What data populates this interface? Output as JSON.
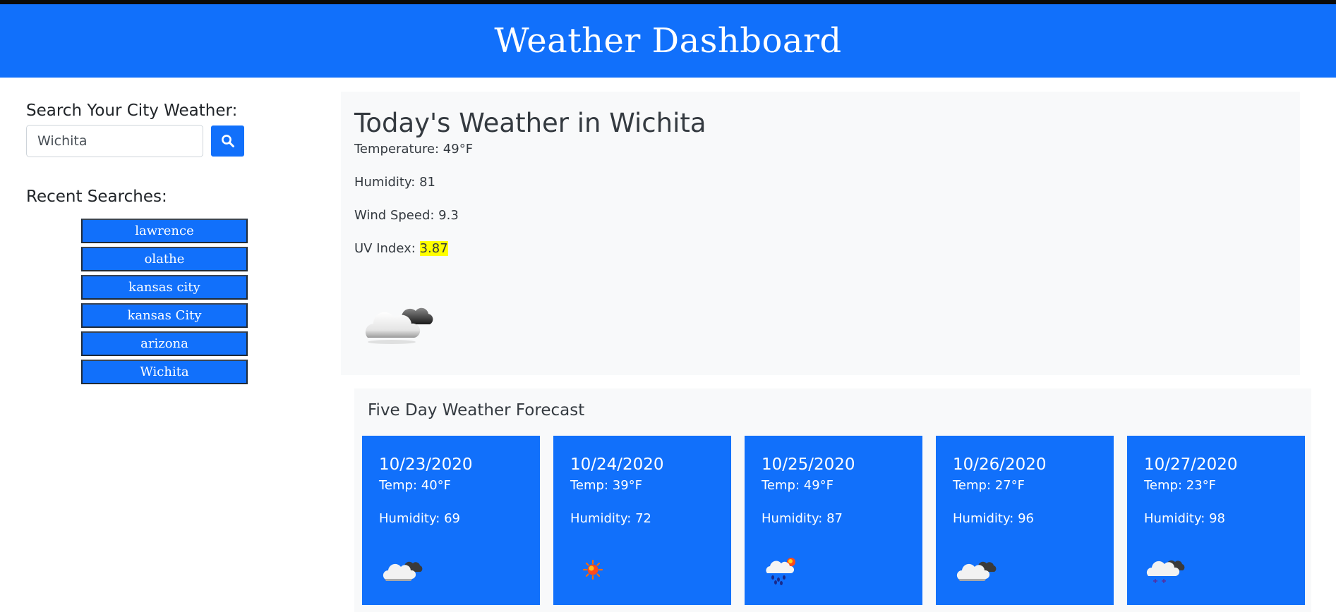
{
  "header": {
    "title": "Weather Dashboard"
  },
  "sidebar": {
    "search_label": "Search Your City Weather:",
    "search_value": "Wichita",
    "recent_label": "Recent Searches:",
    "recent": [
      "lawrence",
      "olathe",
      "kansas city",
      "kansas City",
      "arizona",
      "Wichita"
    ]
  },
  "today": {
    "title": "Today's Weather in Wichita",
    "temperature": "Temperature: 49°F",
    "humidity": "Humidity: 81",
    "wind": "Wind Speed: 9.3",
    "uv_label": "UV Index: ",
    "uv_value": "3.87",
    "icon": "cloudy-night-icon"
  },
  "forecast": {
    "title": "Five Day Weather Forecast",
    "days": [
      {
        "date": "10/23/2020",
        "temp": "Temp: 40°F",
        "humidity": "Humidity: 69",
        "icon": "cloudy-night-icon"
      },
      {
        "date": "10/24/2020",
        "temp": "Temp: 39°F",
        "humidity": "Humidity: 72",
        "icon": "sun-icon"
      },
      {
        "date": "10/25/2020",
        "temp": "Temp: 49°F",
        "humidity": "Humidity: 87",
        "icon": "rain-sun-icon"
      },
      {
        "date": "10/26/2020",
        "temp": "Temp: 27°F",
        "humidity": "Humidity: 96",
        "icon": "cloudy-night-icon"
      },
      {
        "date": "10/27/2020",
        "temp": "Temp: 23°F",
        "humidity": "Humidity: 98",
        "icon": "snow-cloud-icon"
      }
    ]
  },
  "colors": {
    "brand_blue": "#1170fb",
    "uv_highlight": "#ffff00",
    "panel_bg": "#f8f9fa"
  }
}
